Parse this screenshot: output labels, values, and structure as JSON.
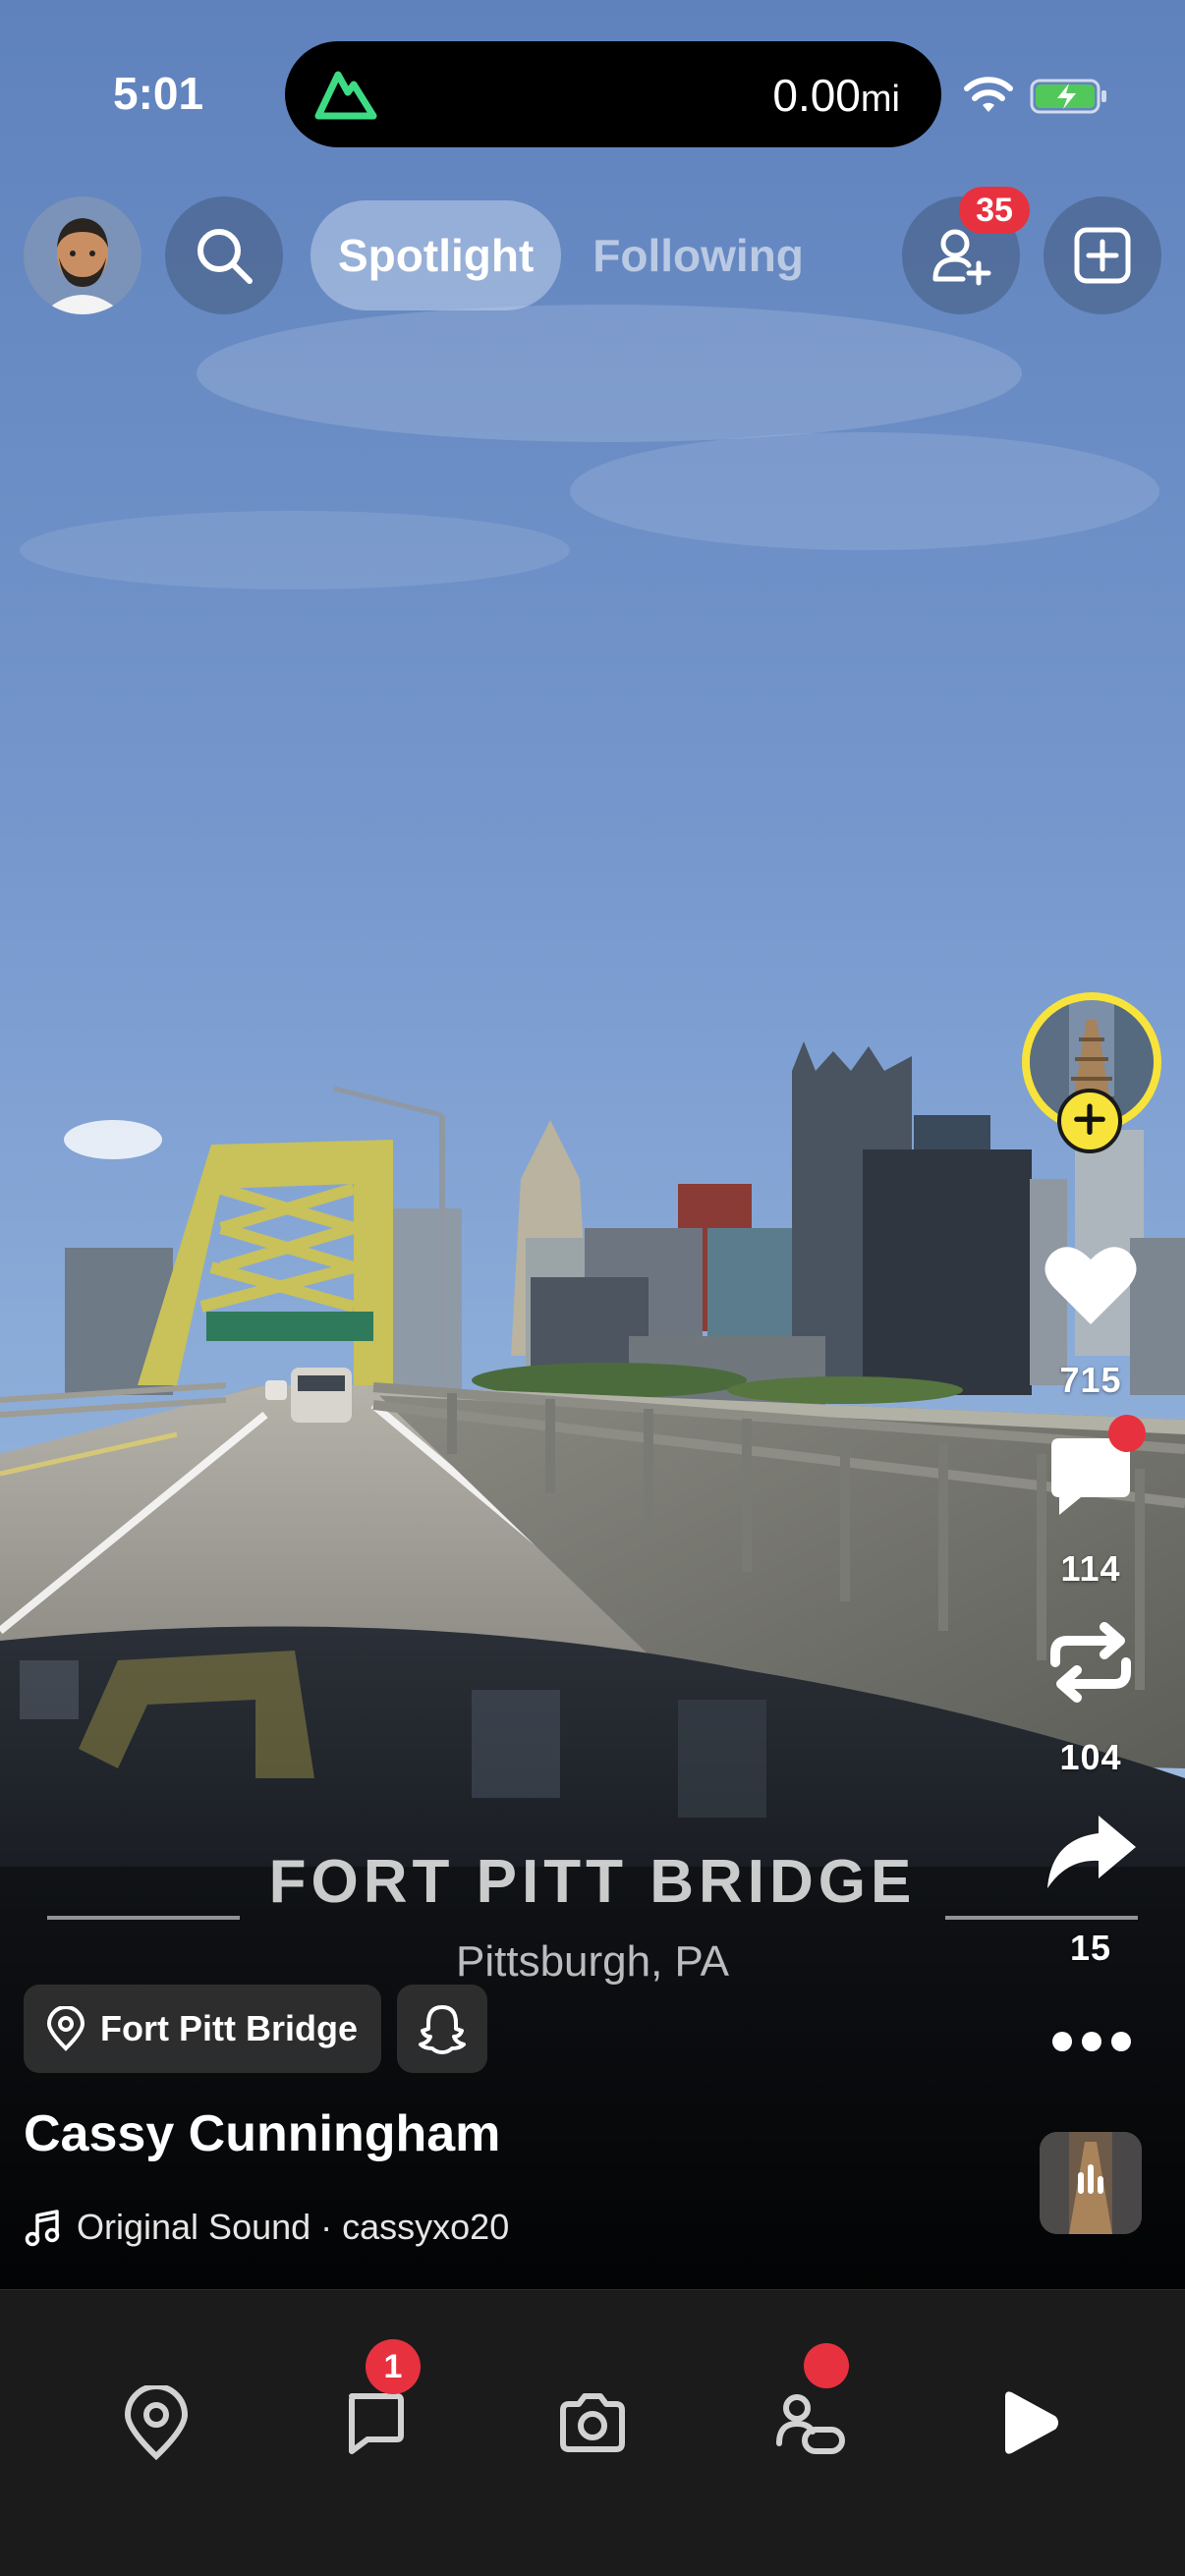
{
  "status_bar": {
    "time": "5:01",
    "island_distance": "0.00",
    "island_unit": "mi"
  },
  "header": {
    "tabs": [
      {
        "label": "Spotlight",
        "active": true
      },
      {
        "label": "Following",
        "active": false
      }
    ],
    "friend_requests_badge": "35"
  },
  "video": {
    "title_overlay": "FORT PITT BRIDGE",
    "subtitle_overlay": "Pittsburgh, PA"
  },
  "actions": {
    "likes": "715",
    "comments": "114",
    "remixes": "104",
    "shares": "15"
  },
  "post": {
    "place_chip": "Fort Pitt Bridge",
    "creator_name": "Cassy Cunningham",
    "sound": "Original Sound · cassyxo20"
  },
  "bottom_nav": {
    "chat_badge": "1",
    "items": [
      "map-icon",
      "chat-icon",
      "camera-icon",
      "stories-icon",
      "spotlight-icon"
    ]
  },
  "colors": {
    "accent_yellow": "#f8e33a",
    "badge_red": "#e8313f",
    "nav_bg": "#1b1b1b",
    "app_green": "#3ddc84"
  }
}
